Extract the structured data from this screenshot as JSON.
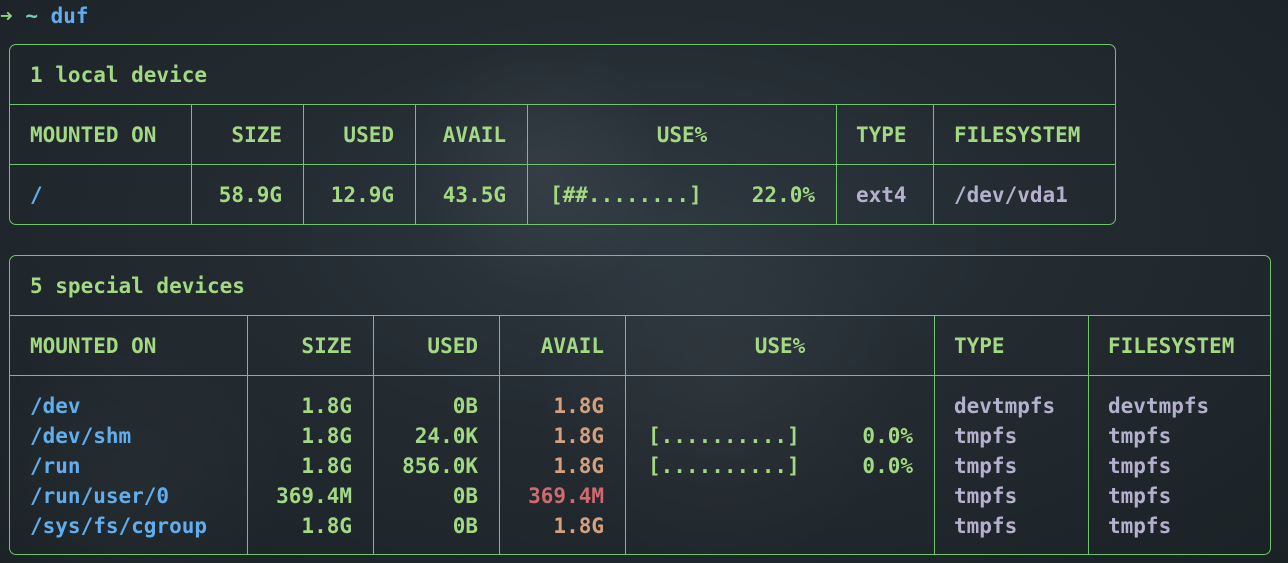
{
  "prompt": {
    "arrow": "➜",
    "tilde": "~",
    "command": "duf"
  },
  "local": {
    "title": "1 local device",
    "headers": [
      "MOUNTED ON",
      "SIZE",
      "USED",
      "AVAIL",
      "USE%",
      "TYPE",
      "FILESYSTEM"
    ],
    "rows": [
      {
        "mounted_on": "/",
        "size": "58.9G",
        "used": "12.9G",
        "avail": "43.5G",
        "use_bar": "[##........]",
        "use_pct": "22.0%",
        "usage_fraction": 0.22,
        "type": "ext4",
        "filesystem": "/dev/vda1"
      }
    ]
  },
  "special": {
    "title": "5 special devices",
    "headers": [
      "MOUNTED ON",
      "SIZE",
      "USED",
      "AVAIL",
      "USE%",
      "TYPE",
      "FILESYSTEM"
    ],
    "rows": [
      {
        "mounted_on": "/dev",
        "size": "1.8G",
        "used": "0B",
        "avail": "1.8G",
        "use_bar": "",
        "use_pct": "",
        "type": "devtmpfs",
        "filesystem": "devtmpfs"
      },
      {
        "mounted_on": "/dev/shm",
        "size": "1.8G",
        "used": "24.0K",
        "avail": "1.8G",
        "use_bar": "[..........]",
        "use_pct": "0.0%",
        "usage_fraction": 0.0,
        "type": "tmpfs",
        "filesystem": "tmpfs"
      },
      {
        "mounted_on": "/run",
        "size": "1.8G",
        "used": "856.0K",
        "avail": "1.8G",
        "use_bar": "[..........]",
        "use_pct": "0.0%",
        "usage_fraction": 0.0,
        "type": "tmpfs",
        "filesystem": "tmpfs"
      },
      {
        "mounted_on": "/run/user/0",
        "size": "369.4M",
        "used": "0B",
        "avail": "369.4M",
        "use_bar": "",
        "use_pct": "",
        "type": "tmpfs",
        "filesystem": "tmpfs"
      },
      {
        "mounted_on": "/sys/fs/cgroup",
        "size": "1.8G",
        "used": "0B",
        "avail": "1.8G",
        "use_bar": "",
        "use_pct": "",
        "type": "tmpfs",
        "filesystem": "tmpfs"
      }
    ]
  },
  "colors": {
    "border": "#6ec66a",
    "header_text": "#a3d982",
    "mount_text": "#61aeee",
    "type_text": "#b6b0cf",
    "avail_warn": "#d4a07e",
    "avail_bad": "#d16a6f"
  }
}
